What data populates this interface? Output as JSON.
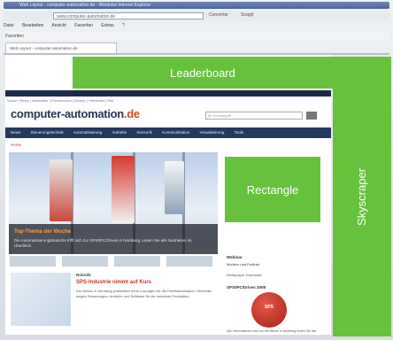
{
  "browser": {
    "title_text": "Web Layout - computer-automation.de - Windows Internet Explorer",
    "address": "www.computer-automation.de",
    "go_left": "Converter",
    "go_right": "Snagit",
    "menu": [
      "Datei",
      "Bearbeiten",
      "Ansicht",
      "Favoriten",
      "Extras",
      "?"
    ],
    "favorites_label": "Favoriten",
    "tab_label": "Web Layout - computer-automation.de"
  },
  "site": {
    "logo_text": "computer-automation",
    "logo_tld": ".de",
    "search_placeholder": "Ihr Suchbegriff",
    "subnav_text": "Suche | News | Newsletter | Fachmessen | Bücher | Heftarchiv | Rss",
    "main_nav": [
      "News",
      "Steuerungstechnik",
      "Automatisierung",
      "Antriebe",
      "Sensorik",
      "Kommunikation",
      "Visualisierung",
      "Tools"
    ],
    "breadcrumb": "Home",
    "hero_caption_title": "Top-Thema der Woche",
    "hero_caption_body": "Die Automatisierungsbranche trifft sich zur SPS/IPC/Drives in Nürnberg. Lesen Sie alle Neuheiten im Überblick.",
    "article_kicker": "Robotik",
    "article_title": "SPS-Industrie nimmt auf Kurs",
    "article_body": "Die Messe in Nürnberg präsentiert neue Lösungen für die Fabrikautomation. Hersteller zeigen Steuerungen, Antriebe und Software für die vernetzte Produktion.",
    "side_heading1": "Webinar",
    "side_line1": "Modbus und Profinet",
    "side_line2": "Whitepaper Download",
    "side_heading2": "SPS/IPC/Drives 2008",
    "badge_text": "SPS",
    "side_foot": "Alle Informationen rund um die Messe in Nürnberg finden Sie hier."
  },
  "ads": {
    "leaderboard": "Leaderboard",
    "rectangle": "Rectangle",
    "skyscraper": "Skyscraper"
  },
  "colors": {
    "ad_green": "#67c13c",
    "nav_dark": "#24395e",
    "accent_red": "#c0392b"
  }
}
